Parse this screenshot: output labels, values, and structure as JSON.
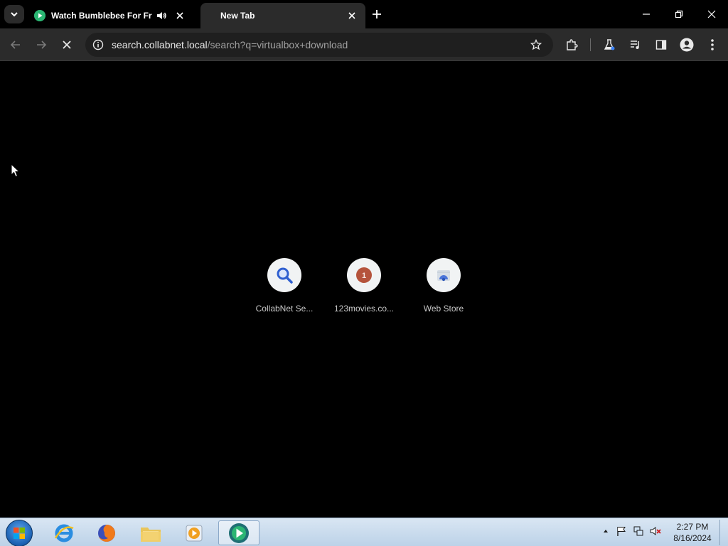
{
  "tabs": [
    {
      "title": "Watch Bumblebee For Free",
      "active": false,
      "audio": true
    },
    {
      "title": "New Tab",
      "active": true,
      "audio": false
    }
  ],
  "toolbar": {
    "url_host": "search.collabnet.local",
    "url_path": "/search?q=virtualbox+download"
  },
  "shortcuts": [
    {
      "label": "CollabNet Se...",
      "icon": "search-icon"
    },
    {
      "label": "123movies.co...",
      "icon": "badge-1-icon",
      "badge": "1"
    },
    {
      "label": "Web Store",
      "icon": "web-store-icon"
    }
  ],
  "taskbar": {
    "apps": [
      "internet-explorer-icon",
      "firefox-icon",
      "file-explorer-icon",
      "media-player-icon",
      "browser-icon"
    ],
    "time": "2:27 PM",
    "date": "8/16/2024"
  },
  "colors": {
    "accent_green": "#2bb673",
    "badge_red": "#b5533c",
    "toolbar_bg": "#2b2b2b"
  }
}
